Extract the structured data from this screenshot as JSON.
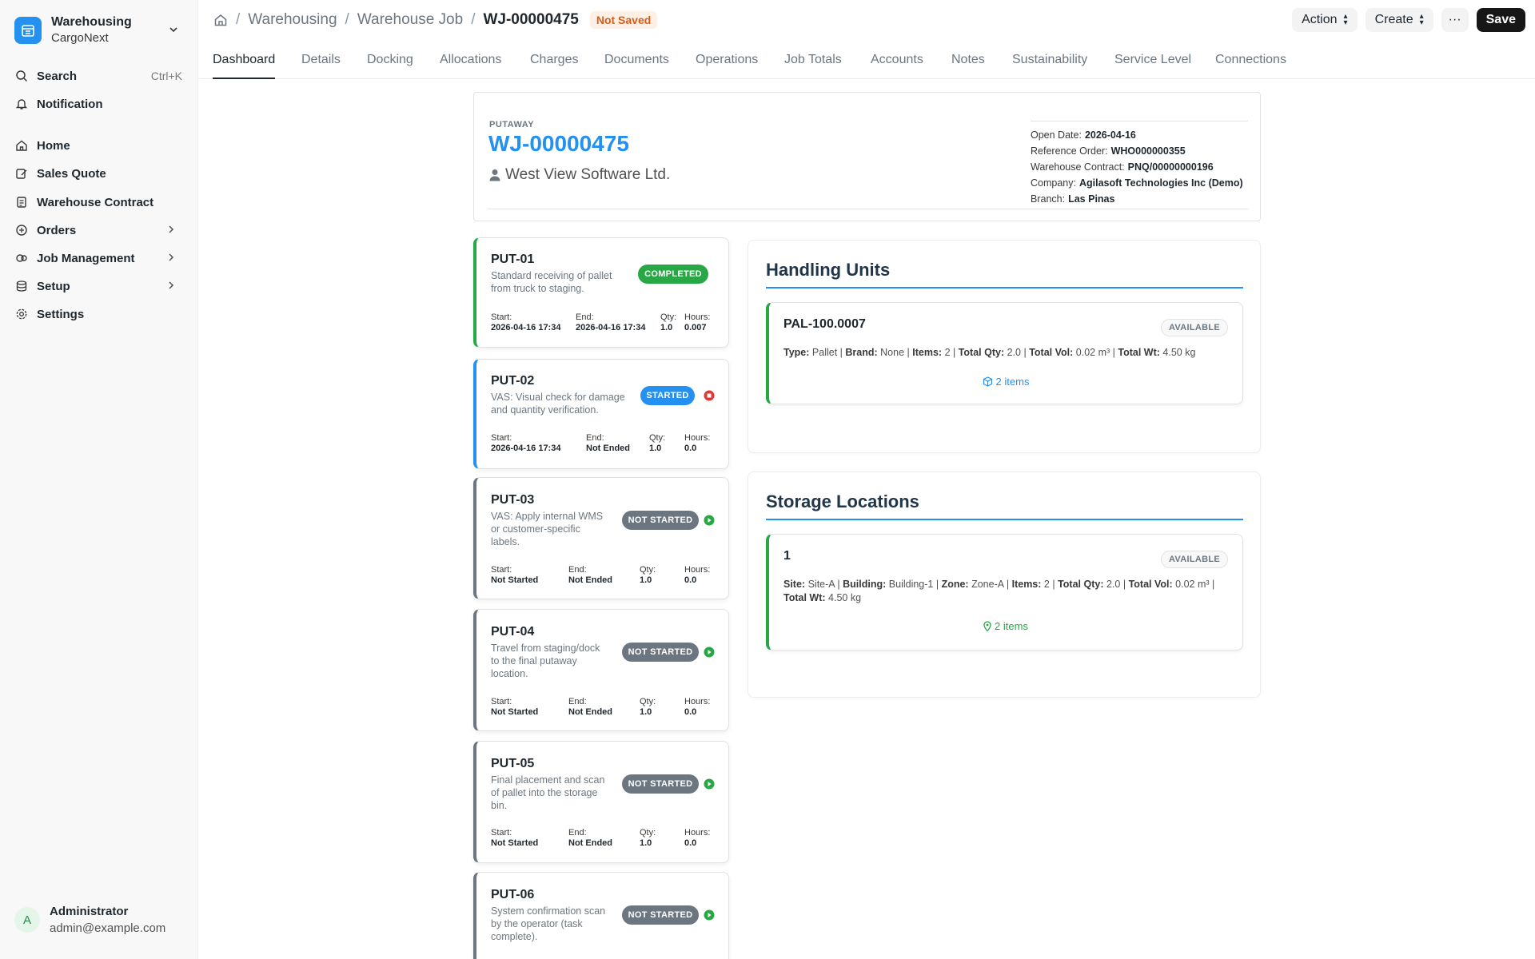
{
  "sidebar": {
    "brand_title": "Warehousing",
    "brand_subtitle": "CargoNext",
    "search_label": "Search",
    "search_shortcut": "Ctrl+K",
    "notification_label": "Notification",
    "items": [
      {
        "label": "Home",
        "icon": "home-icon"
      },
      {
        "label": "Sales Quote",
        "icon": "edit-icon"
      },
      {
        "label": "Warehouse Contract",
        "icon": "contract-icon"
      },
      {
        "label": "Orders",
        "icon": "orders-icon"
      },
      {
        "label": "Job Management",
        "icon": "jobs-icon"
      },
      {
        "label": "Setup",
        "icon": "database-icon"
      },
      {
        "label": "Settings",
        "icon": "gear-icon"
      }
    ],
    "user": {
      "initial": "A",
      "name": "Administrator",
      "email": "admin@example.com"
    }
  },
  "header": {
    "breadcrumbs": [
      "Warehousing",
      "Warehouse Job",
      "WJ-00000475"
    ],
    "status": "Not Saved",
    "action_label": "Action",
    "create_label": "Create",
    "more_label": "···",
    "save_label": "Save"
  },
  "tabs": [
    "Dashboard",
    "Details",
    "Docking",
    "Allocations",
    "Charges",
    "Documents",
    "Operations",
    "Job Totals",
    "Accounts",
    "Notes",
    "Sustainability",
    "Service Level",
    "Connections"
  ],
  "job": {
    "kind": "PUTAWAY",
    "id": "WJ-00000475",
    "customer": "West View Software Ltd.",
    "meta": [
      {
        "label": "Open Date:",
        "value": "2026-04-16"
      },
      {
        "label": "Reference Order:",
        "value": "WHO000000355"
      },
      {
        "label": "Warehouse Contract:",
        "value": "PNQ/00000000196"
      },
      {
        "label": "Company:",
        "value": "Agilasoft Technologies Inc (Demo)"
      },
      {
        "label": "Branch:",
        "value": "Las Pinas"
      }
    ]
  },
  "op_labels": {
    "start": "Start:",
    "end": "End:",
    "qty": "Qty:",
    "hours": "Hours:"
  },
  "operations": [
    {
      "code": "PUT-01",
      "desc": [
        "Standard receiving of pallet",
        "from truck to staging."
      ],
      "status": "COMPLETED",
      "start": "2026-04-16 17:34",
      "end": "2026-04-16 17:34",
      "qty": "1.0",
      "hours": "0.007"
    },
    {
      "code": "PUT-02",
      "desc": [
        "VAS: Visual check for damage",
        "and quantity verification."
      ],
      "status": "STARTED",
      "start": "2026-04-16 17:34",
      "end": "Not Ended",
      "qty": "1.0",
      "hours": "0.0"
    },
    {
      "code": "PUT-03",
      "desc": [
        "VAS: Apply internal WMS",
        "or customer-specific",
        "labels."
      ],
      "status": "NOT STARTED",
      "start": "Not Started",
      "end": "Not Ended",
      "qty": "1.0",
      "hours": "0.0"
    },
    {
      "code": "PUT-04",
      "desc": [
        "Travel from staging/dock",
        "to the final putaway",
        "location."
      ],
      "status": "NOT STARTED",
      "start": "Not Started",
      "end": "Not Ended",
      "qty": "1.0",
      "hours": "0.0"
    },
    {
      "code": "PUT-05",
      "desc": [
        "Final placement and scan",
        "of pallet into the storage",
        "bin."
      ],
      "status": "NOT STARTED",
      "start": "Not Started",
      "end": "Not Ended",
      "qty": "1.0",
      "hours": "0.0"
    },
    {
      "code": "PUT-06",
      "desc": [
        "System confirmation scan",
        "by the operator (task",
        "complete)."
      ],
      "status": "NOT STARTED",
      "start": "",
      "end": "",
      "qty": "",
      "hours": ""
    }
  ],
  "handling_units": {
    "title": "Handling Units",
    "unit": {
      "name": "PAL-100.0007",
      "status": "AVAILABLE",
      "details": [
        {
          "label": "Type:",
          "value": "Pallet"
        },
        {
          "label": "Brand:",
          "value": "None"
        },
        {
          "label": "Items:",
          "value": "2"
        },
        {
          "label": "Total Qty:",
          "value": "2.0"
        },
        {
          "label": "Total Vol:",
          "value": "0.02 m³"
        },
        {
          "label": "Total Wt:",
          "value": "4.50 kg"
        }
      ],
      "items_link": "2 items"
    }
  },
  "storage_locations": {
    "title": "Storage Locations",
    "location": {
      "name": "1",
      "status": "AVAILABLE",
      "details": [
        {
          "label": "Site:",
          "value": "Site-A"
        },
        {
          "label": "Building:",
          "value": "Building-1"
        },
        {
          "label": "Zone:",
          "value": "Zone-A"
        },
        {
          "label": "Items:",
          "value": "2"
        },
        {
          "label": "Total Qty:",
          "value": "2.0"
        },
        {
          "label": "Total Vol:",
          "value": "0.02 m³"
        },
        {
          "label": "Total Wt:",
          "value": "4.50 kg"
        }
      ],
      "items_link": "2 items"
    }
  },
  "colors": {
    "accent": "#2490ef",
    "success": "#28a745",
    "muted": "#6c7680",
    "warning": "#d45d1c"
  }
}
